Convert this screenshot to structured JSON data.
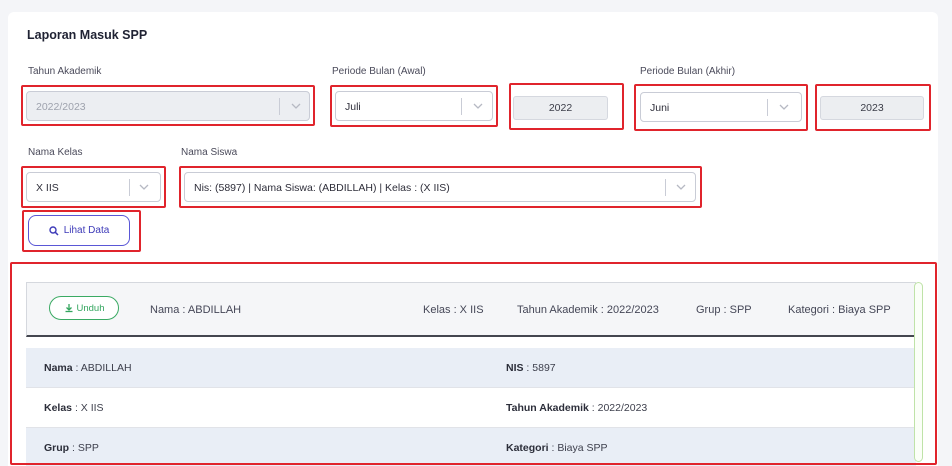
{
  "page_title": "Laporan Masuk SPP",
  "filters": {
    "tahun_akademik": {
      "label": "Tahun Akademik",
      "value": "2022/2023"
    },
    "periode_awal": {
      "label": "Periode Bulan (Awal)",
      "month": "Juli",
      "year": "2022"
    },
    "periode_akhir": {
      "label": "Periode Bulan (Akhir)",
      "month": "Juni",
      "year": "2023"
    },
    "nama_kelas": {
      "label": "Nama Kelas",
      "value": "X IIS"
    },
    "nama_siswa": {
      "label": "Nama Siswa",
      "value": "Nis: (5897) | Nama Siswa: (ABDILLAH) | Kelas : (X IIS)"
    }
  },
  "lihat_button": "Lihat Data",
  "result_header": {
    "unduh_button": "Unduh",
    "nama": "Nama : ABDILLAH",
    "kelas": "Kelas : X IIS",
    "tahun": "Tahun Akademik : 2022/2023",
    "grup": "Grup : SPP",
    "kategori": "Kategori : Biaya SPP"
  },
  "detail_rows": [
    {
      "l_label": "Nama",
      "l_value": " : ABDILLAH",
      "r_label": "NIS",
      "r_value": " : 5897"
    },
    {
      "l_label": "Kelas",
      "l_value": " : X IIS",
      "r_label": "Tahun Akademik",
      "r_value": " : 2022/2023"
    },
    {
      "l_label": "Grup",
      "l_value": " : SPP",
      "r_label": "Kategori",
      "r_value": " : Biaya SPP"
    }
  ],
  "colors": {
    "highlight": "#e0242c",
    "accent": "#5a57d6",
    "success": "#3aaa63"
  }
}
